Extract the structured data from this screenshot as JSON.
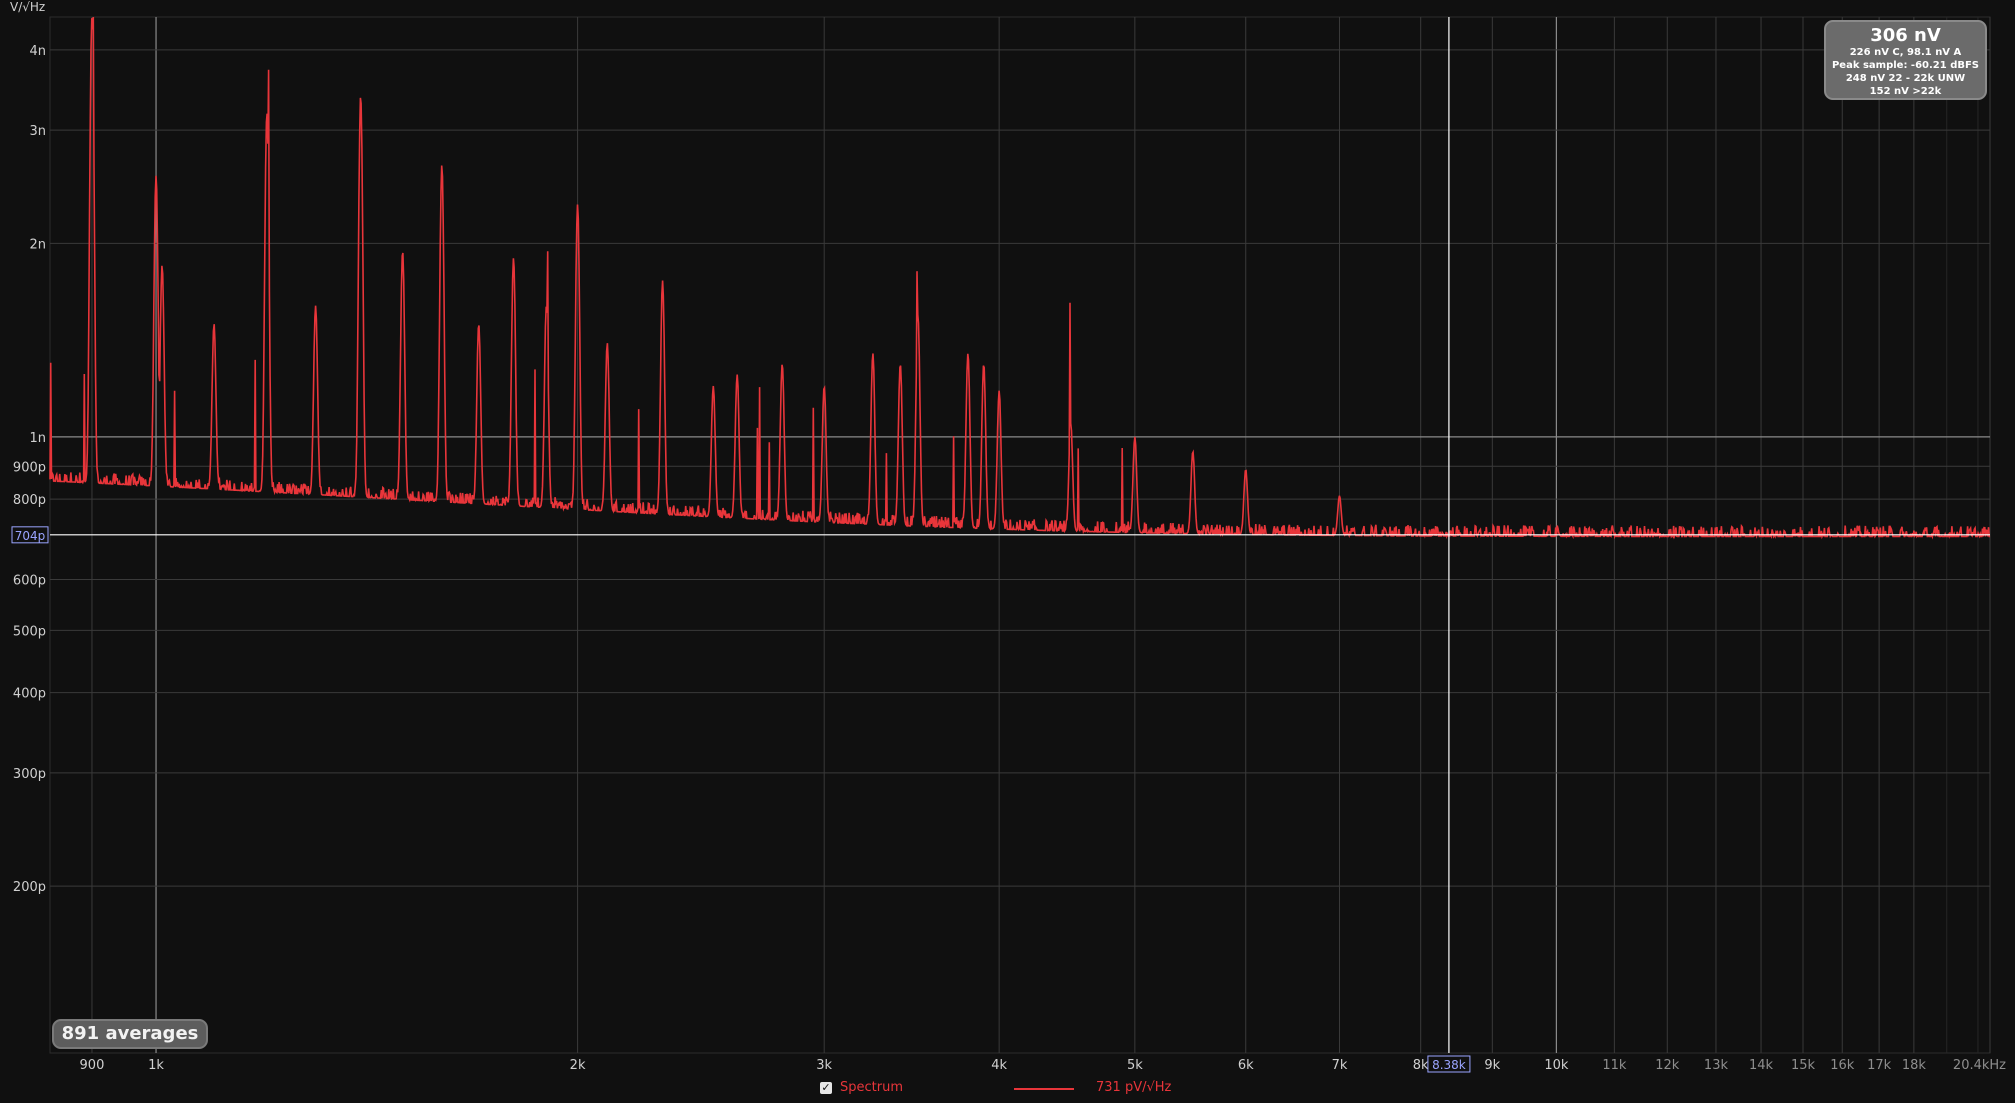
{
  "chart_data": {
    "type": "line",
    "title": "",
    "y_unit_label": "V/√Hz",
    "x_scale": "log",
    "y_scale": "log",
    "x_unit": "Hz",
    "xlim": [
      840,
      20400
    ],
    "ylim": [
      1.1e-10,
      4.5e-09
    ],
    "grid": true,
    "x_ticks": [
      {
        "value": 900,
        "label": "900"
      },
      {
        "value": 1000,
        "label": "1k"
      },
      {
        "value": 2000,
        "label": "2k"
      },
      {
        "value": 3000,
        "label": "3k"
      },
      {
        "value": 4000,
        "label": "4k"
      },
      {
        "value": 5000,
        "label": "5k"
      },
      {
        "value": 6000,
        "label": "6k"
      },
      {
        "value": 7000,
        "label": "7k"
      },
      {
        "value": 8000,
        "label": "8k"
      },
      {
        "value": 9000,
        "label": "9k"
      },
      {
        "value": 10000,
        "label": "10k"
      },
      {
        "value": 11000,
        "label": "11k"
      },
      {
        "value": 12000,
        "label": "12k"
      },
      {
        "value": 13000,
        "label": "13k"
      },
      {
        "value": 14000,
        "label": "14k"
      },
      {
        "value": 15000,
        "label": "15k"
      },
      {
        "value": 16000,
        "label": "16k"
      },
      {
        "value": 17000,
        "label": "17k"
      },
      {
        "value": 18000,
        "label": "18k"
      },
      {
        "value": 20400,
        "label": "20.4kHz"
      }
    ],
    "y_ticks": [
      {
        "value": 4e-09,
        "label": "4n"
      },
      {
        "value": 3e-09,
        "label": "3n"
      },
      {
        "value": 2e-09,
        "label": "2n"
      },
      {
        "value": 1e-09,
        "label": "1n"
      },
      {
        "value": 9e-10,
        "label": "900p"
      },
      {
        "value": 8e-10,
        "label": "800p"
      },
      {
        "value": 6e-10,
        "label": "600p"
      },
      {
        "value": 5e-10,
        "label": "500p"
      },
      {
        "value": 4e-10,
        "label": "400p"
      },
      {
        "value": 3e-10,
        "label": "300p"
      },
      {
        "value": 2e-10,
        "label": "200p"
      }
    ],
    "cursor": {
      "x_value": 8380,
      "x_label": "8.38k",
      "y_value": 7.04e-10,
      "y_label": "704p"
    },
    "series": [
      {
        "name": "Spectrum",
        "color": "#e8353a",
        "noise_floor": 7e-10,
        "peaks": [
          {
            "x": 900,
            "y": 4.5e-09
          },
          {
            "x": 1000,
            "y": 2.55e-09
          },
          {
            "x": 1010,
            "y": 1.85e-09
          },
          {
            "x": 1100,
            "y": 1.5e-09
          },
          {
            "x": 1200,
            "y": 3.2e-09
          },
          {
            "x": 1300,
            "y": 1.6e-09
          },
          {
            "x": 1400,
            "y": 3.4e-09
          },
          {
            "x": 1500,
            "y": 1.95e-09
          },
          {
            "x": 1600,
            "y": 2.65e-09
          },
          {
            "x": 1700,
            "y": 1.5e-09
          },
          {
            "x": 1800,
            "y": 1.9e-09
          },
          {
            "x": 1900,
            "y": 1.6e-09
          },
          {
            "x": 2000,
            "y": 2.3e-09
          },
          {
            "x": 2100,
            "y": 1.4e-09
          },
          {
            "x": 2300,
            "y": 1.75e-09
          },
          {
            "x": 2500,
            "y": 1.2e-09
          },
          {
            "x": 2600,
            "y": 1.25e-09
          },
          {
            "x": 2800,
            "y": 1.3e-09
          },
          {
            "x": 3000,
            "y": 1.2e-09
          },
          {
            "x": 3250,
            "y": 1.35e-09
          },
          {
            "x": 3400,
            "y": 1.3e-09
          },
          {
            "x": 3500,
            "y": 1.55e-09
          },
          {
            "x": 3800,
            "y": 1.35e-09
          },
          {
            "x": 3900,
            "y": 1.3e-09
          },
          {
            "x": 4000,
            "y": 1.18e-09
          },
          {
            "x": 4500,
            "y": 1.05e-09
          },
          {
            "x": 5000,
            "y": 1e-09
          },
          {
            "x": 5500,
            "y": 9.5e-10
          },
          {
            "x": 6000,
            "y": 8.9e-10
          },
          {
            "x": 7000,
            "y": 8.1e-10
          }
        ]
      }
    ]
  },
  "stats": {
    "main": "306 nV",
    "lines": [
      "226 nV C, 98.1 nV A",
      "Peak sample: -60.21 dBFS",
      "248 nV 22 - 22k UNW",
      "152 nV >22k"
    ]
  },
  "averages_badge": "891 averages",
  "legend": {
    "checkbox_checked": true,
    "series_name": "Spectrum",
    "cursor_value": "731 pV/√Hz"
  },
  "colors": {
    "background": "#101010",
    "grid": "#3a3a3a",
    "axis_text": "#d0d0d0",
    "trace": "#e8353a",
    "cursor": "#ffffff",
    "cursor_label": "#9aa4ff"
  }
}
